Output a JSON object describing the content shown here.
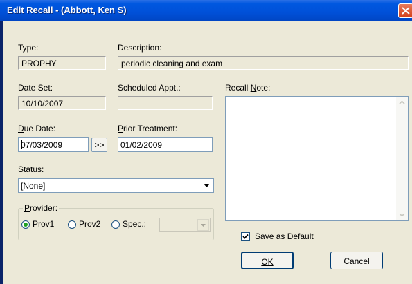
{
  "window": {
    "title": "Edit Recall - (Abbott, Ken S)"
  },
  "fields": {
    "type_label": "Type:",
    "type_value": "PROPHY",
    "description_label": "Description:",
    "description_value": "periodic cleaning and exam",
    "date_set_label": "Date Set:",
    "date_set_value": "10/10/2007",
    "scheduled_appt_label": "Scheduled Appt.:",
    "scheduled_appt_value": "",
    "due_date_label_hotkey": "D",
    "due_date_label_rest": "ue Date:",
    "due_date_value": "07/03/2009",
    "advance_button_label": ">>",
    "prior_treatment_label_hotkey": "P",
    "prior_treatment_label_rest": "rior Treatment:",
    "prior_treatment_value": "01/02/2009",
    "status_label_pre": "St",
    "status_label_hotkey": "a",
    "status_label_post": "tus:",
    "status_value": "[None]",
    "recall_note_label_pre": "Recall ",
    "recall_note_label_hotkey": "N",
    "recall_note_label_post": "ote:",
    "recall_note_value": ""
  },
  "provider": {
    "group_label_hotkey": "P",
    "group_label_rest": "rovider:",
    "options": [
      {
        "label": "Prov1",
        "selected": true
      },
      {
        "label": "Prov2",
        "selected": false
      },
      {
        "label": "Spec.:",
        "selected": false
      }
    ],
    "spec_value": ""
  },
  "save_default": {
    "label_pre": "Sa",
    "label_hotkey": "v",
    "label_post": "e as Default",
    "checked": true
  },
  "buttons": {
    "ok_label": "OK",
    "cancel_label": "Cancel"
  },
  "icons": {
    "close": "close-icon",
    "dropdown": "chevron-down-icon",
    "scroll_up": "scroll-up-icon",
    "scroll_down": "scroll-down-icon"
  }
}
